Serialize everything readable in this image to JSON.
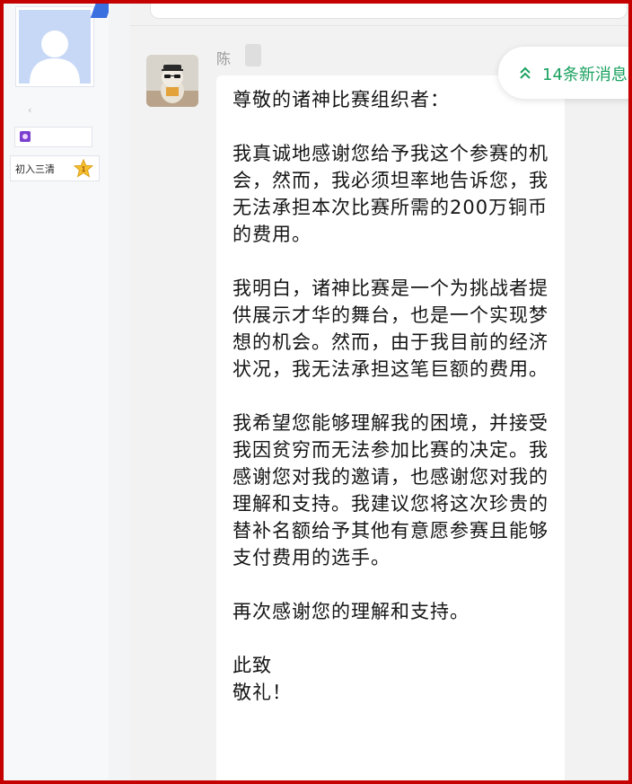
{
  "sidebar": {
    "username_blurred": "",
    "chevron": "‹",
    "medal_icon": "medal-icon",
    "level_label": "初入三清",
    "level_badge": "1"
  },
  "chat": {
    "sender_name": "陈",
    "new_messages_label": "14条新消息",
    "message": {
      "greeting": "尊敬的诸神比赛组织者：",
      "paragraphs": [
        "我真诚地感谢您给予我这个参赛的机会，然而，我必须坦率地告诉您，我无法承担本次比赛所需的200万铜币的费用。",
        "我明白，诸神比赛是一个为挑战者提供展示才华的舞台，也是一个实现梦想的机会。然而，由于我目前的经济状况，我无法承担这笔巨额的费用。",
        "我希望您能够理解我的困境，并接受我因贫穷而无法参加比赛的决定。我感谢您对我的邀请，也感谢您对我的理解和支持。我建议您将这次珍贵的替补名额给予其他有意愿参赛且能够支付费用的选手。",
        "再次感谢您的理解和支持。"
      ],
      "closing_1": "此致",
      "closing_2": "敬礼！"
    }
  },
  "colors": {
    "frame": "#c40000",
    "accent_green": "#19a15f",
    "chat_bg": "#f2f2f2",
    "bubble_bg": "#ffffff"
  }
}
